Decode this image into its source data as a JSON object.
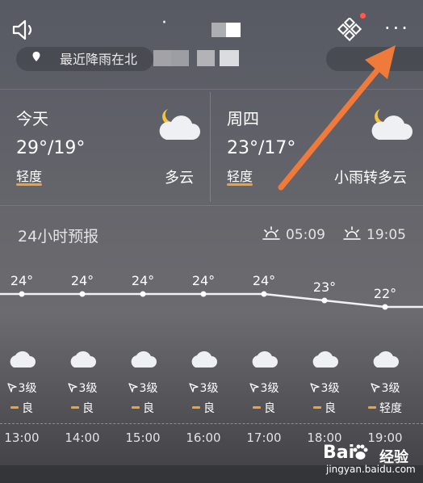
{
  "header": {
    "city_title": "·",
    "more_label": "···",
    "alert_banner": "最近降雨在北"
  },
  "days": [
    {
      "name": "今天",
      "temp": "29°/19°",
      "aqi": "轻度",
      "condition": "多云",
      "icon": "partly-cloudy-night-icon"
    },
    {
      "name": "周四",
      "temp": "23°/17°",
      "aqi": "轻度",
      "condition": "小雨转多云",
      "icon": "partly-cloudy-night-icon"
    }
  ],
  "forecast": {
    "title": "24小时预报",
    "sunrise": "05:09",
    "sunset": "19:05",
    "hours": [
      {
        "temp": "24°",
        "temp_value": 24,
        "wind": "3级",
        "aqi": "良",
        "time": "13:00"
      },
      {
        "temp": "24°",
        "temp_value": 24,
        "wind": "3级",
        "aqi": "良",
        "time": "14:00"
      },
      {
        "temp": "24°",
        "temp_value": 24,
        "wind": "3级",
        "aqi": "良",
        "time": "15:00"
      },
      {
        "temp": "24°",
        "temp_value": 24,
        "wind": "3级",
        "aqi": "良",
        "time": "16:00"
      },
      {
        "temp": "24°",
        "temp_value": 24,
        "wind": "3级",
        "aqi": "良",
        "time": "17:00"
      },
      {
        "temp": "23°",
        "temp_value": 23,
        "wind": "3级",
        "aqi": "良",
        "time": "18:00"
      },
      {
        "temp": "22°",
        "temp_value": 22,
        "wind": "3级",
        "aqi": "轻度",
        "time": "19:00"
      }
    ]
  },
  "watermark": {
    "logo": "Bai",
    "brand": "经验",
    "url": "jingyan.baidu.com"
  },
  "colors": {
    "aqi_accent": "#f0a137",
    "arrow": "#f07a3a",
    "notification_dot": "#ff5a4e"
  }
}
